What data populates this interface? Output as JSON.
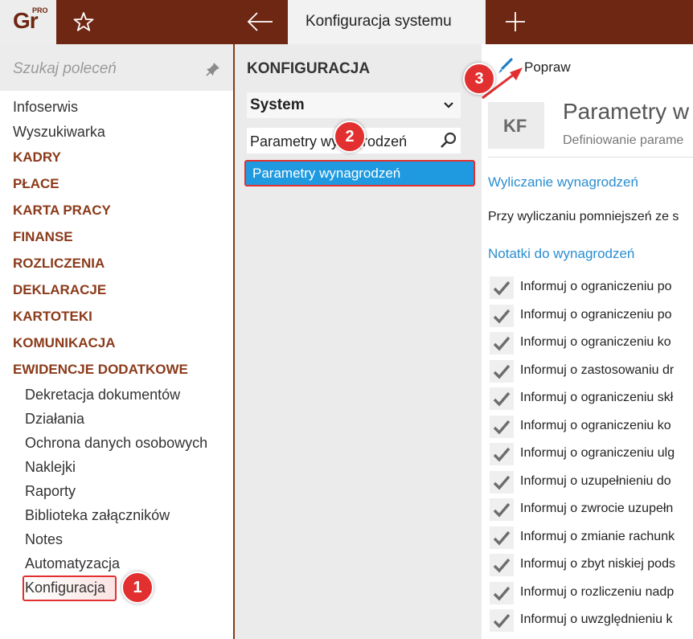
{
  "topbar": {
    "logo_text": "Gr",
    "logo_badge": "PRO",
    "active_tab": "Konfiguracja systemu",
    "icons": {
      "favorite": "star-icon",
      "back": "arrow-left-icon",
      "new_tab": "plus-icon"
    }
  },
  "sidebar": {
    "search_placeholder": "Szukaj poleceń",
    "items": [
      {
        "label": "Infoserwis",
        "type": "item"
      },
      {
        "label": "Wyszukiwarka",
        "type": "item"
      },
      {
        "label": "KADRY",
        "type": "category"
      },
      {
        "label": "PŁACE",
        "type": "category"
      },
      {
        "label": "KARTA PRACY",
        "type": "category"
      },
      {
        "label": "FINANSE",
        "type": "category"
      },
      {
        "label": "ROZLICZENIA",
        "type": "category"
      },
      {
        "label": "DEKLARACJE",
        "type": "category"
      },
      {
        "label": "KARTOTEKI",
        "type": "category"
      },
      {
        "label": "KOMUNIKACJA",
        "type": "category"
      },
      {
        "label": "EWIDENCJE DODATKOWE",
        "type": "category"
      },
      {
        "label": "Dekretacja dokumentów",
        "type": "sub"
      },
      {
        "label": "Działania",
        "type": "sub"
      },
      {
        "label": "Ochrona danych osobowych",
        "type": "sub"
      },
      {
        "label": "Naklejki",
        "type": "sub"
      },
      {
        "label": "Raporty",
        "type": "sub"
      },
      {
        "label": "Biblioteka załączników",
        "type": "sub"
      },
      {
        "label": "Notes",
        "type": "sub"
      },
      {
        "label": "Automatyzacja",
        "type": "sub"
      },
      {
        "label": "Konfiguracja",
        "type": "sub",
        "selected": true
      }
    ]
  },
  "middle": {
    "title": "KONFIGURACJA",
    "select_value": "System",
    "filter_value": "Parametry wynagrodzeń",
    "list": [
      {
        "label": "Parametry wynagrodzeń",
        "selected": true
      }
    ]
  },
  "content": {
    "edit_label": "Popraw",
    "icon_badge": "KF",
    "title": "Parametry w",
    "subtitle": "Definiowanie parame",
    "section1": "Wyliczanie wynagrodzeń",
    "section1_text": "Przy wyliczaniu pomniejszeń ze s",
    "section2": "Notatki do wynagrodzeń",
    "checks": [
      "Informuj o ograniczeniu po",
      "Informuj o ograniczeniu po",
      "Informuj o ograniczeniu ko",
      "Informuj o zastosowaniu dr",
      "Informuj o ograniczeniu skł",
      "Informuj o ograniczeniu ko",
      "Informuj o ograniczeniu ulg",
      "Informuj o uzupełnieniu do",
      "Informuj o zwrocie uzupełn",
      "Informuj o zmianie rachunk",
      "Informuj o zbyt niskiej pods",
      "Informuj o rozliczeniu nadp",
      "Informuj o uwzględnieniu k"
    ]
  },
  "callouts": [
    "1",
    "2",
    "3"
  ],
  "colors": {
    "brand": "#6e2712",
    "category": "#8b3a1a",
    "accent": "#1f9ae0",
    "callout": "#e23030",
    "link": "#2a8ed0"
  }
}
